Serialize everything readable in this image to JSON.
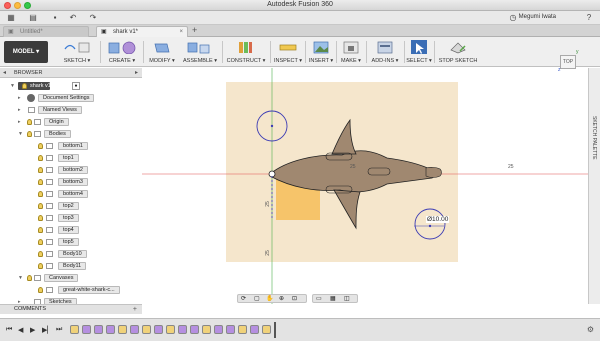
{
  "window": {
    "title": "Autodesk Fusion 360"
  },
  "quick_access": {
    "user_name": "Megumi Iwata"
  },
  "tabs": [
    {
      "label": "Untitled*"
    },
    {
      "label": "shark v1*"
    }
  ],
  "toolbar": {
    "workspace_label": "MODEL ▾",
    "groups": [
      {
        "label": "SKETCH ▾"
      },
      {
        "label": "CREATE ▾"
      },
      {
        "label": "MODIFY ▾"
      },
      {
        "label": "ASSEMBLE ▾"
      },
      {
        "label": "CONSTRUCT ▾"
      },
      {
        "label": "INSPECT ▾"
      },
      {
        "label": "INSERT ▾"
      },
      {
        "label": "MAKE ▾"
      },
      {
        "label": "ADD-INS ▾"
      },
      {
        "label": "SELECT ▾"
      },
      {
        "label": "STOP SKETCH"
      }
    ]
  },
  "browser": {
    "header": "BROWSER",
    "root": "shark v1",
    "nodes": [
      {
        "label": "Document Settings"
      },
      {
        "label": "Named Views"
      },
      {
        "label": "Origin"
      },
      {
        "label": "Bodies"
      },
      {
        "label": "bottom1"
      },
      {
        "label": "top1"
      },
      {
        "label": "bottom2"
      },
      {
        "label": "bottom3"
      },
      {
        "label": "bottom4"
      },
      {
        "label": "top2"
      },
      {
        "label": "top3"
      },
      {
        "label": "top4"
      },
      {
        "label": "top5"
      },
      {
        "label": "Body10"
      },
      {
        "label": "Body11"
      },
      {
        "label": "Canvases"
      },
      {
        "label": "great-white-shark-c..."
      },
      {
        "label": "Sketches"
      }
    ]
  },
  "comments": {
    "label": "COMMENTS"
  },
  "canvas": {
    "dimension_label": "Ø10.00",
    "axis_label_25_top": "25",
    "axis_label_25_bottom": "25",
    "axis_label_right": "25",
    "axis_label_top": "25",
    "viewcube_label": "TOP",
    "sketch_palette_label": "SKETCH PALETTE"
  },
  "colors": {
    "canvas_image_bg": "#f5e6cc",
    "shark_fill": "#a08870",
    "selection_fill": "#f5b84a",
    "sketch_circle": "#3c3cb4",
    "x_axis": "#e05050",
    "y_axis": "#4fb04f"
  }
}
